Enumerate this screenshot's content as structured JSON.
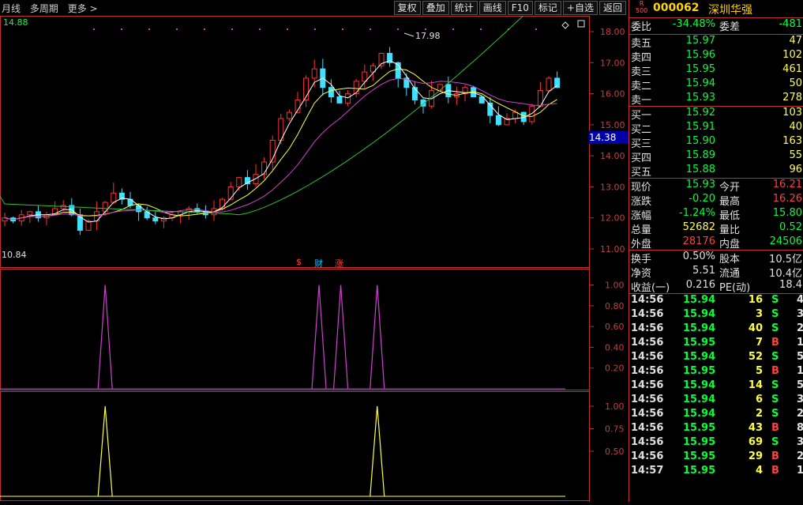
{
  "toolbar": {
    "left": [
      "月线",
      "多周期",
      "更多 >"
    ],
    "right": [
      "复权",
      "叠加",
      "统计",
      "画线",
      "F10",
      "标记",
      "+自选",
      "返回"
    ]
  },
  "chart_main": {
    "top_left_value": "14.88",
    "bottom_left_value": "10.84",
    "high_label": "17.98",
    "price_tag": "14.38",
    "y_ticks": [
      "18.00",
      "17.00",
      "16.00",
      "15.00",
      "14.00",
      "13.00",
      "12.00",
      "11.00"
    ],
    "badges": [
      "$",
      "财",
      "涨"
    ]
  },
  "indicator1": {
    "y_ticks": [
      "1.00",
      "0.80",
      "0.60",
      "0.40",
      "0.20"
    ],
    "spikes_at": [
      0.15,
      0.455,
      0.486,
      0.538
    ],
    "color": "#d040d0"
  },
  "indicator2": {
    "y_ticks": [
      "1.00",
      "0.75",
      "0.50"
    ],
    "spikes_at": [
      0.15,
      0.538
    ],
    "color": "#ffff40"
  },
  "stock": {
    "r_badge": "R",
    "r_number": "500",
    "code": "000062",
    "name": "深圳华强"
  },
  "weibi": {
    "label": "委比",
    "value": "-34.48%",
    "label2": "委差",
    "value2": "-481"
  },
  "asks": [
    {
      "label": "卖五",
      "price": "15.97",
      "vol": "47"
    },
    {
      "label": "卖四",
      "price": "15.96",
      "vol": "102"
    },
    {
      "label": "卖三",
      "price": "15.95",
      "vol": "461"
    },
    {
      "label": "卖二",
      "price": "15.94",
      "vol": "50"
    },
    {
      "label": "卖一",
      "price": "15.93",
      "vol": "278"
    }
  ],
  "bids": [
    {
      "label": "买一",
      "price": "15.92",
      "vol": "103"
    },
    {
      "label": "买二",
      "price": "15.91",
      "vol": "40"
    },
    {
      "label": "买三",
      "price": "15.90",
      "vol": "163"
    },
    {
      "label": "买四",
      "price": "15.89",
      "vol": "55"
    },
    {
      "label": "买五",
      "price": "15.88",
      "vol": "96"
    }
  ],
  "quote": [
    {
      "l": "现价",
      "v": "15.93",
      "l2": "今开",
      "v2": "16.21"
    },
    {
      "l": "涨跌",
      "v": "-0.20",
      "l2": "最高",
      "v2": "16.26"
    },
    {
      "l": "涨幅",
      "v": "-1.24%",
      "l2": "最低",
      "v2": "15.80"
    },
    {
      "l": "总量",
      "v": "52682",
      "l2": "量比",
      "v2": "0.52"
    },
    {
      "l": "外盘",
      "v": "28176",
      "l2": "内盘",
      "v2": "24506"
    }
  ],
  "fund": [
    {
      "l": "换手",
      "v": "0.50%",
      "l2": "股本",
      "v2": "10.5亿"
    },
    {
      "l": "净资",
      "v": "5.51",
      "l2": "流通",
      "v2": "10.4亿"
    },
    {
      "l": "收益(一)",
      "v": "0.216",
      "l2": "PE(动)",
      "v2": "18.4"
    }
  ],
  "ticks": [
    {
      "t": "14:56",
      "p": "15.94",
      "v": "16",
      "s": "S",
      "n": "4"
    },
    {
      "t": "14:56",
      "p": "15.94",
      "v": "3",
      "s": "S",
      "n": "3"
    },
    {
      "t": "14:56",
      "p": "15.94",
      "v": "40",
      "s": "S",
      "n": "2"
    },
    {
      "t": "14:56",
      "p": "15.95",
      "v": "7",
      "s": "B",
      "n": "1"
    },
    {
      "t": "14:56",
      "p": "15.94",
      "v": "52",
      "s": "S",
      "n": "5"
    },
    {
      "t": "14:56",
      "p": "15.95",
      "v": "5",
      "s": "B",
      "n": "1"
    },
    {
      "t": "14:56",
      "p": "15.94",
      "v": "14",
      "s": "S",
      "n": "5"
    },
    {
      "t": "14:56",
      "p": "15.94",
      "v": "6",
      "s": "S",
      "n": "3"
    },
    {
      "t": "14:56",
      "p": "15.94",
      "v": "2",
      "s": "S",
      "n": "2"
    },
    {
      "t": "14:56",
      "p": "15.95",
      "v": "43",
      "s": "B",
      "n": "8"
    },
    {
      "t": "14:56",
      "p": "15.95",
      "v": "69",
      "s": "S",
      "n": "3"
    },
    {
      "t": "14:56",
      "p": "15.95",
      "v": "29",
      "s": "B",
      "n": "2"
    },
    {
      "t": "14:57",
      "p": "15.95",
      "v": "4",
      "s": "B",
      "n": "1"
    }
  ]
}
